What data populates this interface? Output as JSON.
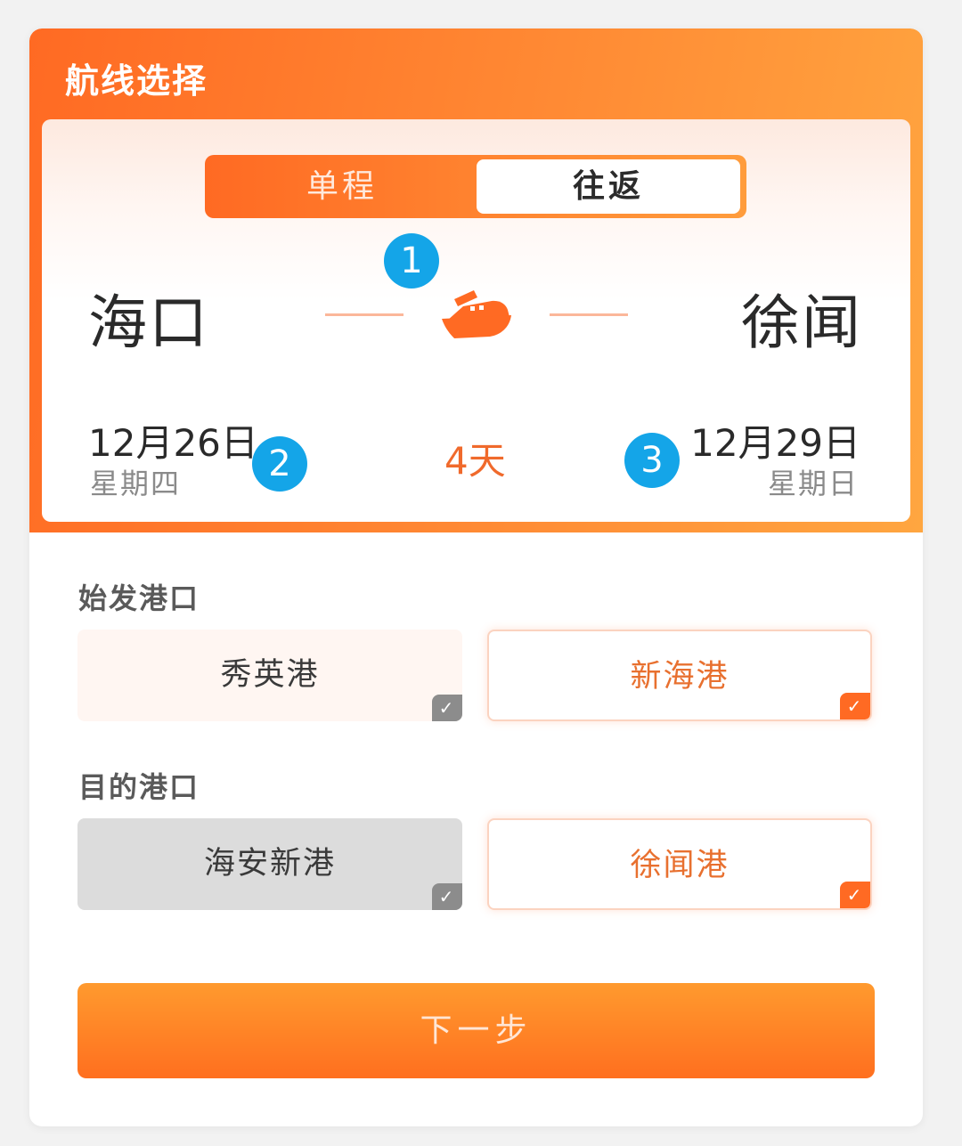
{
  "header": {
    "title": "航线选择"
  },
  "trip_type": {
    "one_way": "单程",
    "round_trip": "往返",
    "selected": "round_trip"
  },
  "route": {
    "from_city": "海口",
    "to_city": "徐闻",
    "depart_date": "12月26日",
    "depart_weekday": "星期四",
    "return_date": "12月29日",
    "return_weekday": "星期日",
    "duration": "4天",
    "icon": "ship-icon"
  },
  "annotations": [
    "1",
    "2",
    "3"
  ],
  "departure_port": {
    "label": "始发港口",
    "options": [
      {
        "name": "秀英港",
        "selected": false
      },
      {
        "name": "新海港",
        "selected": true
      }
    ]
  },
  "destination_port": {
    "label": "目的港口",
    "options": [
      {
        "name": "海安新港",
        "selected": false
      },
      {
        "name": "徐闻港",
        "selected": true
      }
    ]
  },
  "actions": {
    "next": "下一步"
  },
  "colors": {
    "accent": "#ff6a23",
    "badge": "#14a5e8",
    "selected_text": "#e8702f"
  }
}
